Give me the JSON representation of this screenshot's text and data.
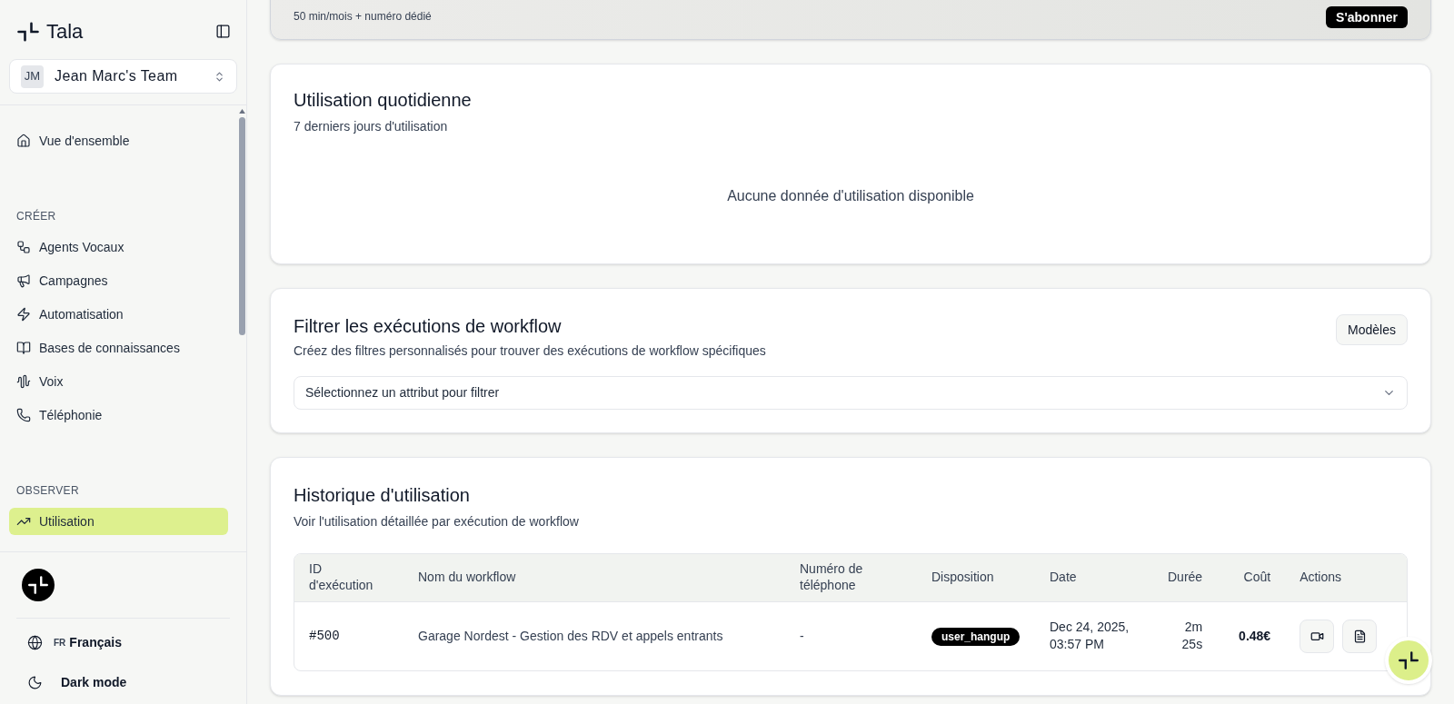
{
  "brand": {
    "name": "Tala"
  },
  "team": {
    "initials": "JM",
    "name": "Jean Marc's Team"
  },
  "nav": [
    {
      "kind": "item",
      "label": "Vue d'ensemble",
      "selected": false
    },
    {
      "kind": "section",
      "label": "CRÉER"
    },
    {
      "kind": "item",
      "label": "Agents Vocaux",
      "selected": false
    },
    {
      "kind": "item",
      "label": "Campagnes",
      "selected": false
    },
    {
      "kind": "item",
      "label": "Automatisation",
      "selected": false
    },
    {
      "kind": "item",
      "label": "Bases de connaissances",
      "selected": false
    },
    {
      "kind": "item",
      "label": "Voix",
      "selected": false
    },
    {
      "kind": "item",
      "label": "Téléphonie",
      "selected": false
    },
    {
      "kind": "section",
      "label": "OBSERVER"
    },
    {
      "kind": "item",
      "label": "Utilisation",
      "selected": true
    }
  ],
  "footer": {
    "language_code": "FR",
    "language": "Français",
    "theme": "Dark mode"
  },
  "upgrade": {
    "subtitle": "50 min/mois + numéro dédié",
    "button": "S'abonner"
  },
  "daily_usage": {
    "title": "Utilisation quotidienne",
    "subtitle": "7 derniers jours d'utilisation",
    "empty": "Aucune donnée d'utilisation disponible"
  },
  "filter": {
    "title": "Filtrer les exécutions de workflow",
    "subtitle": "Créez des filtres personnalisés pour trouver des exécutions de workflow spécifiques",
    "button": "Modèles",
    "select_placeholder": "Sélectionnez un attribut pour filtrer"
  },
  "history": {
    "title": "Historique d'utilisation",
    "subtitle": "Voir l'utilisation détaillée par exécution de workflow",
    "columns": [
      "ID d'exécution",
      "Nom du workflow",
      "Numéro de téléphone",
      "Disposition",
      "Date",
      "Durée",
      "Coût",
      "Actions"
    ],
    "rows": [
      {
        "id": "#500",
        "workflow": "Garage Nordest - Gestion des RDV et appels entrants",
        "phone": "-",
        "disposition": "user_hangup",
        "date": "Dec 24, 2025, 03:57 PM",
        "duration": "2m 25s",
        "cost": "0.48€"
      }
    ]
  }
}
